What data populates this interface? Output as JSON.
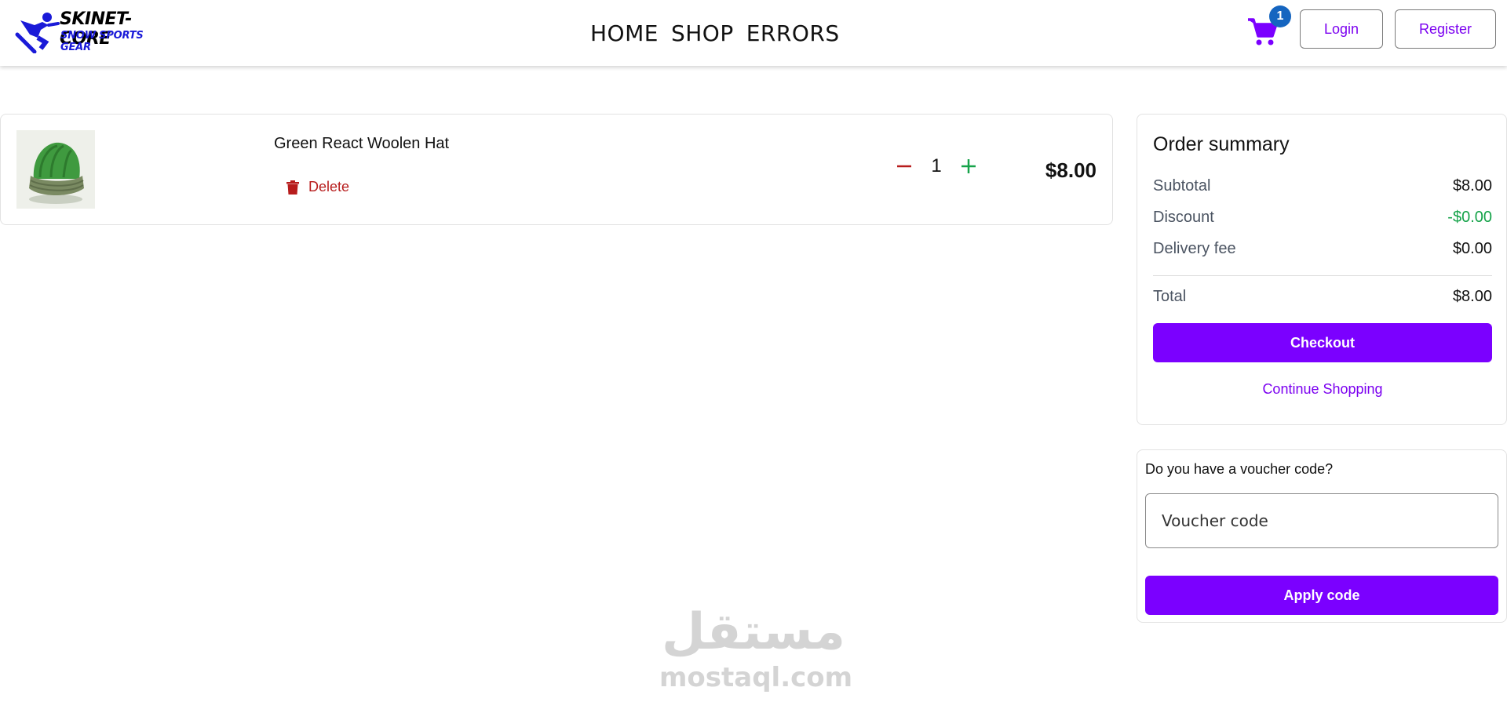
{
  "header": {
    "logo": {
      "title": "SKINET-CORE",
      "subtitle": "SNOW SPORTS GEAR"
    },
    "nav": [
      "HOME",
      "SHOP",
      "ERRORS"
    ],
    "cart_count": "1",
    "login_label": "Login",
    "register_label": "Register"
  },
  "cart": {
    "items": [
      {
        "name": "Green React Woolen Hat",
        "delete_label": "Delete",
        "quantity": "1",
        "price": "$8.00"
      }
    ]
  },
  "summary": {
    "title": "Order summary",
    "subtotal_label": "Subtotal",
    "subtotal": "$8.00",
    "discount_label": "Discount",
    "discount": "-$0.00",
    "delivery_label": "Delivery fee",
    "delivery": "$0.00",
    "total_label": "Total",
    "total": "$8.00",
    "checkout_label": "Checkout",
    "continue_label": "Continue Shopping"
  },
  "voucher": {
    "question": "Do you have a voucher code?",
    "placeholder": "Voucher code",
    "apply_label": "Apply code"
  },
  "watermark": {
    "arabic": "مستقل",
    "latin": "mostaql.com"
  },
  "colors": {
    "accent": "#7b00ff",
    "delete": "#b71c1c",
    "plus": "#16a34a",
    "badge": "#1565c0",
    "discount": "#16a34a"
  }
}
